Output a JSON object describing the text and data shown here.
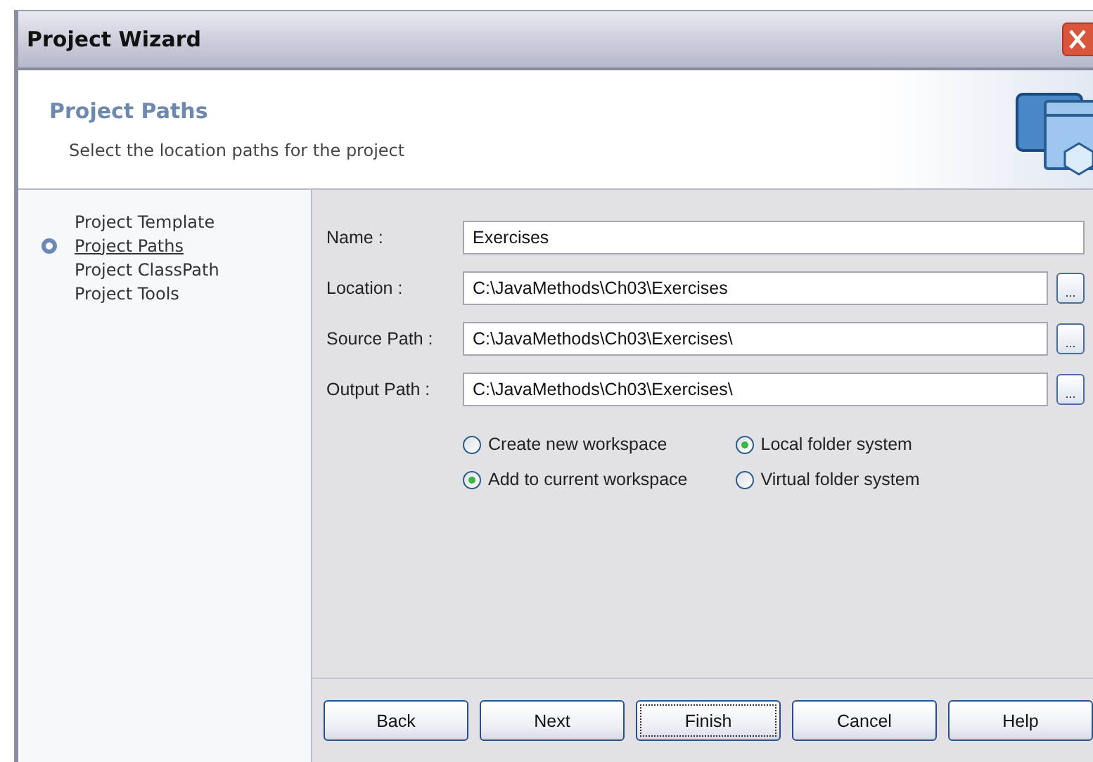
{
  "window": {
    "title": "Project Wizard"
  },
  "header": {
    "title": "Project Paths",
    "subtitle": "Select the location paths for the project"
  },
  "steps": [
    {
      "label": "Project Template",
      "selected": false
    },
    {
      "label": "Project Paths",
      "selected": true
    },
    {
      "label": "Project ClassPath",
      "selected": false
    },
    {
      "label": "Project Tools",
      "selected": false
    }
  ],
  "fields": [
    {
      "label": "Name :",
      "value": "Exercises",
      "browse": false
    },
    {
      "label": "Location :",
      "value": "C:\\JavaMethods\\Ch03\\Exercises",
      "browse": true,
      "browse_label": "..."
    },
    {
      "label": "Source Path :",
      "value": "C:\\JavaMethods\\Ch03\\Exercises\\",
      "browse": true,
      "browse_label": "..."
    },
    {
      "label": "Output Path :",
      "value": "C:\\JavaMethods\\Ch03\\Exercises\\",
      "browse": true,
      "browse_label": "..."
    }
  ],
  "workspace_options": [
    {
      "label": "Create new workspace",
      "selected": false
    },
    {
      "label": "Add to current workspace",
      "selected": true
    }
  ],
  "folder_options": [
    {
      "label": "Local folder system",
      "selected": true
    },
    {
      "label": "Virtual folder system",
      "selected": false
    }
  ],
  "buttons": [
    {
      "label": "Back",
      "focused": false
    },
    {
      "label": "Next",
      "focused": false
    },
    {
      "label": "Finish",
      "focused": true
    },
    {
      "label": "Cancel",
      "focused": false
    },
    {
      "label": "Help",
      "focused": false
    }
  ]
}
